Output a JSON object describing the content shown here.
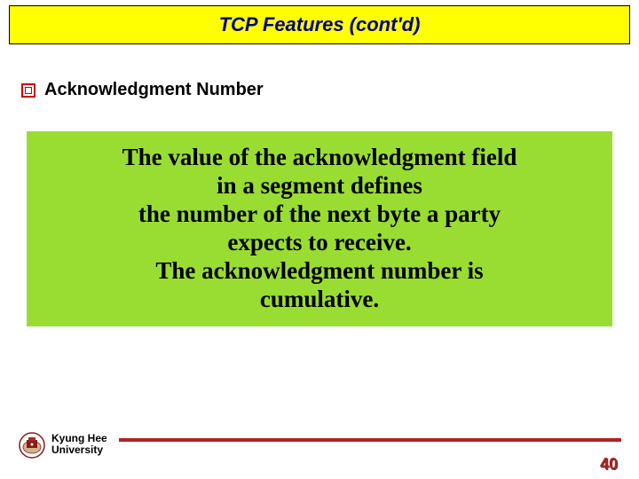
{
  "title": "TCP Features (cont'd)",
  "bullet": {
    "label": "Acknowledgment Number"
  },
  "highlight": {
    "line1": "The value of the acknowledgment field",
    "line2": "in a segment defines",
    "line3": "the number of the next byte a party",
    "line4": "expects to receive.",
    "line5": "The acknowledgment number is",
    "line6": "cumulative."
  },
  "footer": {
    "institution_line1": "Kyung Hee",
    "institution_line2": "University",
    "page_number": "40"
  }
}
